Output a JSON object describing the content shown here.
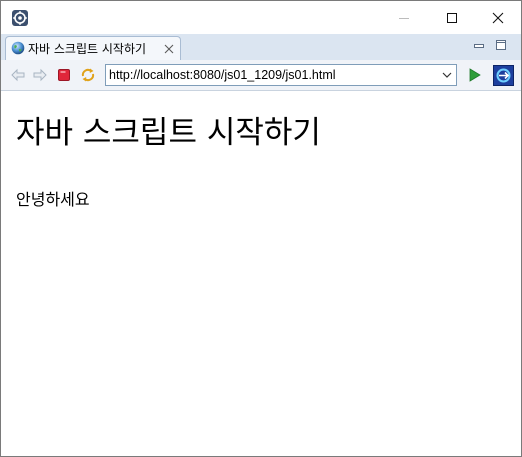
{
  "window": {
    "minimize_icon": "minimize-icon",
    "maximize_icon": "maximize-icon",
    "close_icon": "close-icon"
  },
  "tab": {
    "title": "자바 스크립트 시작하기",
    "icon": "globe-icon",
    "close_icon": "close-icon"
  },
  "toolbar": {
    "url": "http://localhost:8080/js01_1209/js01.html",
    "back_icon": "back-arrow-icon",
    "forward_icon": "forward-arrow-icon",
    "stop_icon": "stop-icon",
    "refresh_icon": "refresh-icon",
    "go_icon": "go-icon"
  },
  "page": {
    "heading": "자바 스크립트 시작하기",
    "body_text": "안녕하세요"
  },
  "colors": {
    "tab_strip": "#dbe5f1",
    "toolbar": "#f0f3f8",
    "stop_red": "#e0263a",
    "go_green": "#2e9e3a"
  }
}
